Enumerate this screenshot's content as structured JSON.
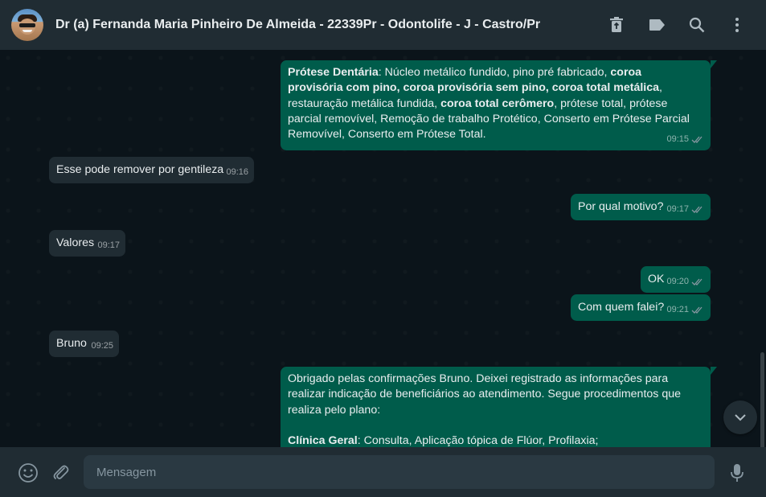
{
  "header": {
    "title": "Dr (a) Fernanda Maria Pinheiro De Almeida - 22339Pr - Odontolife - J - Castro/Pr",
    "icons": [
      "delete-icon",
      "label-icon",
      "search-icon",
      "menu-icon"
    ]
  },
  "messages": [
    {
      "direction": "out",
      "bold_heading": "Prótese Dentária",
      "seg1": ": Núcleo metálico fundido, pino pré fabricado, ",
      "bold2": "coroa provisória com pino, coroa provisória sem pino, coroa total metálica",
      "seg2": ", restauração metálica fundida, ",
      "bold3": "coroa total cerômero",
      "seg3": ", prótese total, prótese parcial removível, Remoção de trabalho Protético, Conserto em Prótese Parcial Removível, Conserto em Prótese Total.",
      "time": "09:15"
    },
    {
      "direction": "in",
      "text": "Esse pode remover por gentileza",
      "time": "09:16"
    },
    {
      "direction": "out",
      "text": "Por qual motivo?",
      "time": "09:17"
    },
    {
      "direction": "in",
      "text": "Valores",
      "time": "09:17"
    },
    {
      "direction": "out",
      "text": "OK",
      "time": "09:20"
    },
    {
      "direction": "out",
      "text": "Com quem falei?",
      "time": "09:21"
    },
    {
      "direction": "in",
      "text": "Bruno",
      "time": "09:25"
    },
    {
      "direction": "out",
      "text": "Obrigado pelas confirmações Bruno. Deixei registrado as informações para realizar indicação de beneficiários ao atendimento. Segue procedimentos que realiza pelo plano:",
      "bold_heading": "Clínica Geral",
      "seg1": ": Consulta, Aplicação tópica de Flúor, Profilaxia;"
    }
  ],
  "footer": {
    "placeholder": "Mensagem",
    "icons": [
      "emoji-icon",
      "attach-icon",
      "microphone-icon"
    ]
  },
  "colors": {
    "header_bg": "#202c33",
    "chat_bg": "#0b141a",
    "outgoing_bubble": "#005c4b",
    "incoming_bubble": "#202c33",
    "read_tick": "#8696a0"
  }
}
